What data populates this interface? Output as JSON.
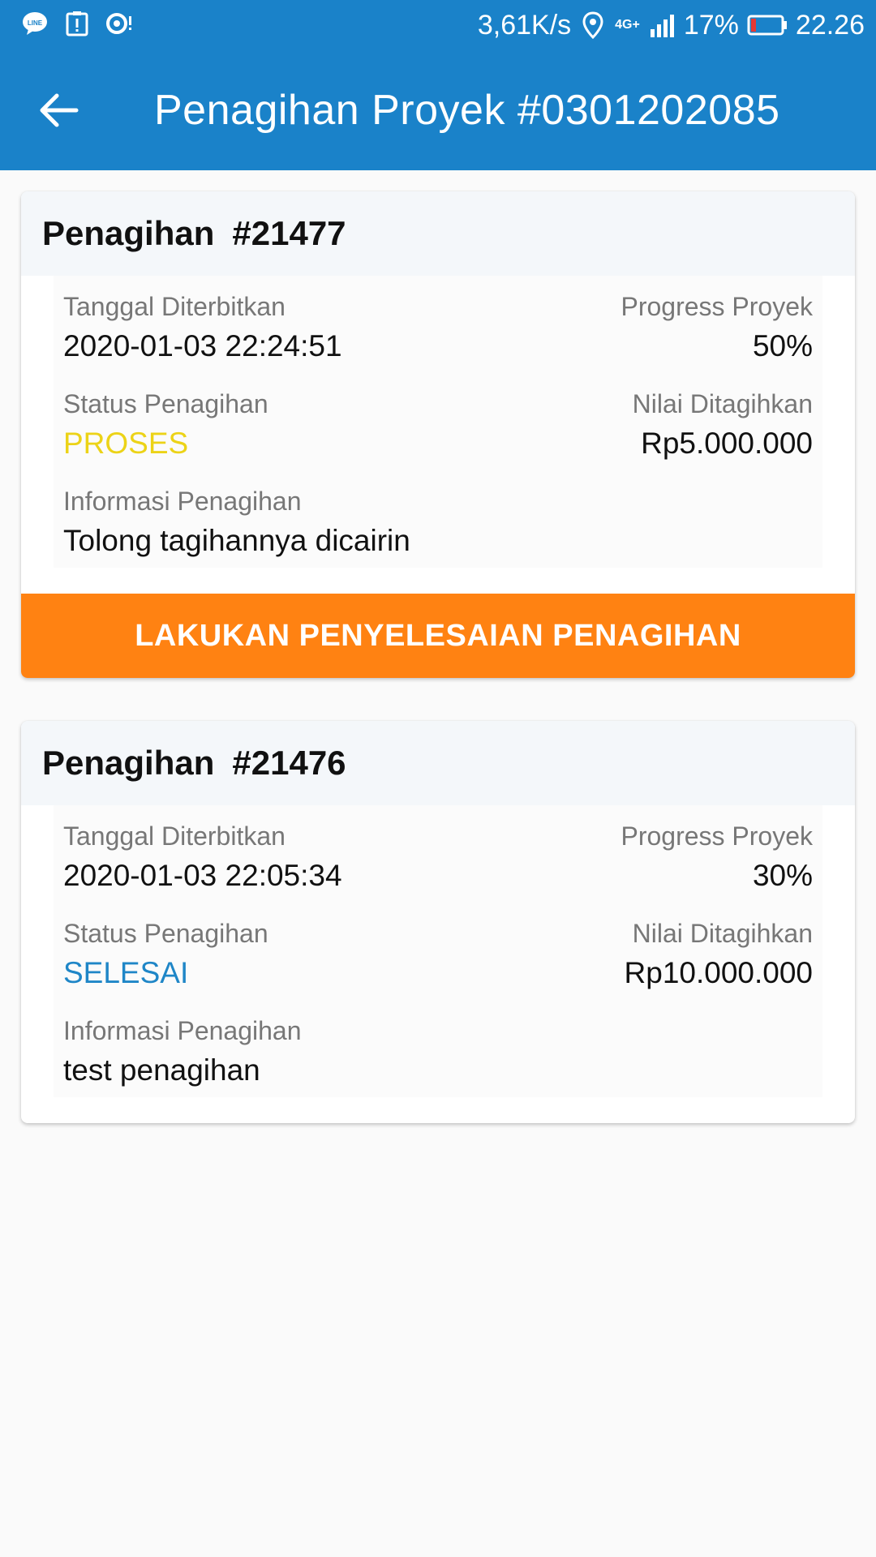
{
  "status_bar": {
    "speed": "3,61K/s",
    "network": "4G+",
    "battery": "17%",
    "time": "22.26",
    "icons": [
      "line-icon",
      "alert-icon",
      "sync-icon",
      "location-icon",
      "signal-icon",
      "battery-icon"
    ]
  },
  "appbar": {
    "title": "Penagihan Proyek #0301202085",
    "back_icon": "arrow-left-icon"
  },
  "colors": {
    "primary": "#1a82c9",
    "accent": "#ff8212",
    "status_proses": "#ecd317",
    "status_selesai": "#1f86c7"
  },
  "invoices": [
    {
      "label": "Penagihan",
      "number": "#21477",
      "date_label": "Tanggal Diterbitkan",
      "date": "2020-01-03 22:24:51",
      "progress_label": "Progress Proyek",
      "progress": "50%",
      "status_label": "Status Penagihan",
      "status": "PROSES",
      "amount_label": "Nilai Ditagihkan",
      "amount": "Rp5.000.000",
      "info_label": "Informasi Penagihan",
      "info": "Tolong tagihannya dicairin",
      "action": "LAKUKAN PENYELESAIAN PENAGIHAN"
    },
    {
      "label": "Penagihan",
      "number": "#21476",
      "date_label": "Tanggal Diterbitkan",
      "date": "2020-01-03 22:05:34",
      "progress_label": "Progress Proyek",
      "progress": "30%",
      "status_label": "Status Penagihan",
      "status": "SELESAI",
      "amount_label": "Nilai Ditagihkan",
      "amount": "Rp10.000.000",
      "info_label": "Informasi Penagihan",
      "info": "test penagihan"
    }
  ]
}
